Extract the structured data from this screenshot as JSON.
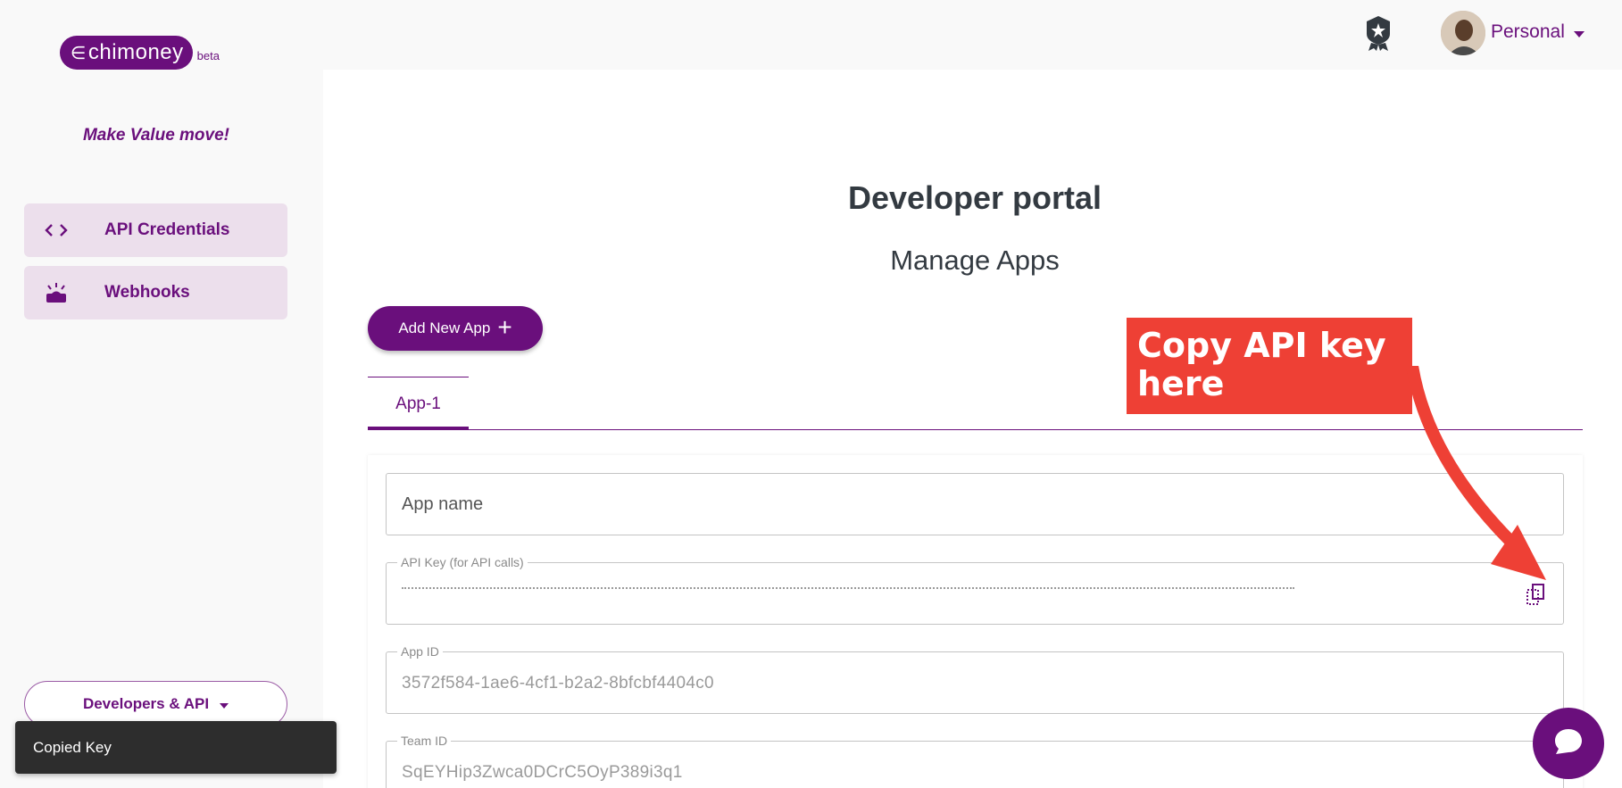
{
  "brand": {
    "name": "chimoney",
    "badge": "beta",
    "tagline": "Make Value move!"
  },
  "sidebar": {
    "items": [
      {
        "label": "API Credentials",
        "icon": "code-icon"
      },
      {
        "label": "Webhooks",
        "icon": "webhook-icon"
      }
    ],
    "dropdown_label": "Developers & API"
  },
  "header": {
    "account_label": "Personal"
  },
  "main": {
    "title": "Developer portal",
    "subtitle": "Manage Apps",
    "add_button": "Add New App",
    "tabs": [
      {
        "label": "App-1",
        "active": true
      }
    ],
    "fields": {
      "app_name": {
        "placeholder": "App name"
      },
      "api_key": {
        "label": "API Key (for API calls)"
      },
      "app_id": {
        "label": "App ID",
        "value": "3572f584-1ae6-4cf1-b2a2-8bfcbf4404c0"
      },
      "team_id": {
        "label": "Team ID",
        "value": "SqEYHip3Zwca0DCrC5OyP389i3q1"
      }
    }
  },
  "annotation": {
    "text": "Copy API key here"
  },
  "toast": {
    "message": "Copied Key"
  },
  "colors": {
    "brand": "#6a0f7c",
    "nav_bg": "#ecdfec",
    "annotation": "#ee4035"
  }
}
